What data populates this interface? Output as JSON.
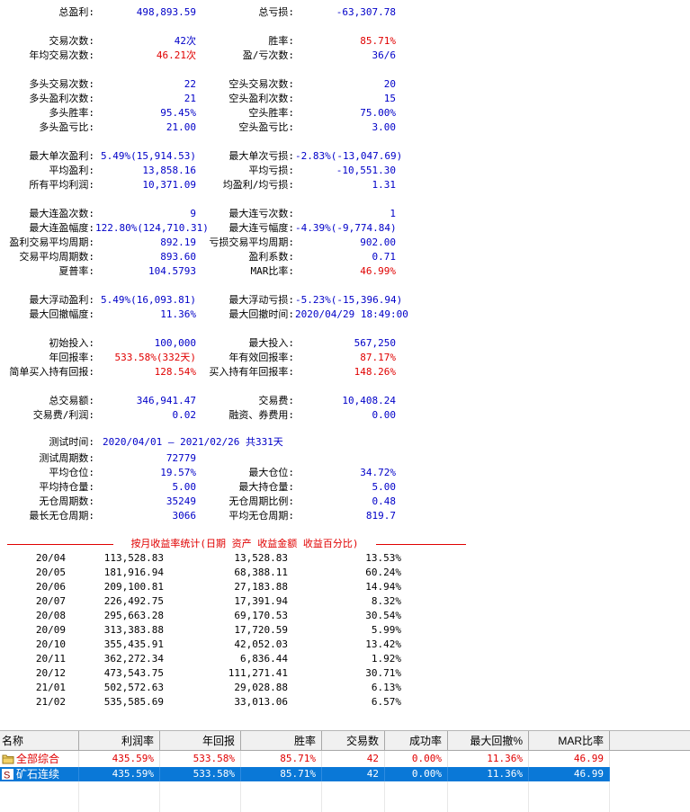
{
  "stats": [
    {
      "row": "r1",
      "l1": "总盈利:",
      "v1": "498,893.59",
      "c1": "blue",
      "l2": "总亏损:",
      "v2": "-63,307.78",
      "c2": "blue"
    },
    {
      "row": "r2",
      "l1": "交易次数:",
      "v1": "42次",
      "c1": "blue",
      "l2": "胜率:",
      "v2": "85.71%",
      "c2": "red"
    },
    {
      "row": "r3",
      "l1": "年均交易次数:",
      "v1": "46.21次",
      "c1": "red",
      "l2": "盈/亏次数:",
      "v2": "36/6",
      "c2": "blue"
    },
    {
      "row": "r4",
      "l1": "多头交易次数:",
      "v1": "22",
      "c1": "blue",
      "l2": "空头交易次数:",
      "v2": "20",
      "c2": "blue"
    },
    {
      "row": "r5",
      "l1": "多头盈利次数:",
      "v1": "21",
      "c1": "blue",
      "l2": "空头盈利次数:",
      "v2": "15",
      "c2": "blue"
    },
    {
      "row": "r6",
      "l1": "多头胜率:",
      "v1": "95.45%",
      "c1": "blue",
      "l2": "空头胜率:",
      "v2": "75.00%",
      "c2": "blue"
    },
    {
      "row": "r7",
      "l1": "多头盈亏比:",
      "v1": "21.00",
      "c1": "blue",
      "l2": "空头盈亏比:",
      "v2": "3.00",
      "c2": "blue"
    },
    {
      "row": "r8",
      "l1": "最大单次盈利:",
      "v1": "5.49%(15,914.53)",
      "c1": "blue",
      "l2": "最大单次亏损:",
      "v2": "-2.83%(-13,047.69)",
      "c2": "blue"
    },
    {
      "row": "r9",
      "l1": "平均盈利:",
      "v1": "13,858.16",
      "c1": "blue",
      "l2": "平均亏损:",
      "v2": "-10,551.30",
      "c2": "blue"
    },
    {
      "row": "r10",
      "l1": "所有平均利润:",
      "v1": "10,371.09",
      "c1": "blue",
      "l2": "均盈利/均亏损:",
      "v2": "1.31",
      "c2": "blue"
    },
    {
      "row": "r11",
      "l1": "最大连盈次数:",
      "v1": "9",
      "c1": "blue",
      "l2": "最大连亏次数:",
      "v2": "1",
      "c2": "blue"
    },
    {
      "row": "r12",
      "l1": "最大连盈幅度:",
      "v1": "122.80%(124,710.31)",
      "c1": "blue",
      "l2": "最大连亏幅度:",
      "v2": "-4.39%(-9,774.84)",
      "c2": "blue"
    },
    {
      "row": "r13",
      "l1": "盈利交易平均周期:",
      "v1": "892.19",
      "c1": "blue",
      "l2": "亏损交易平均周期:",
      "v2": "902.00",
      "c2": "blue"
    },
    {
      "row": "r14",
      "l1": "交易平均周期数:",
      "v1": "893.60",
      "c1": "blue",
      "l2": "盈利系数:",
      "v2": "0.71",
      "c2": "blue"
    },
    {
      "row": "r15",
      "l1": "夏普率:",
      "v1": "104.5793",
      "c1": "blue",
      "l2": "MAR比率:",
      "v2": "46.99%",
      "c2": "red"
    },
    {
      "row": "r16",
      "l1": "最大浮动盈利:",
      "v1": "5.49%(16,093.81)",
      "c1": "blue",
      "l2": "最大浮动亏损:",
      "v2": "-5.23%(-15,396.94)",
      "c2": "blue"
    },
    {
      "row": "r17",
      "l1": "最大回撤幅度:",
      "v1": "11.36%",
      "c1": "blue",
      "l2": "最大回撤时间:",
      "v2": "2020/04/29 18:49:00",
      "c2": "blue"
    },
    {
      "row": "r18",
      "l1": "初始投入:",
      "v1": "100,000",
      "c1": "blue",
      "l2": "最大投入:",
      "v2": "567,250",
      "c2": "blue"
    },
    {
      "row": "r19",
      "l1": "年回报率:",
      "v1": "533.58%(332天)",
      "c1": "red",
      "l2": "年有效回报率:",
      "v2": "87.17%",
      "c2": "red"
    },
    {
      "row": "r20",
      "l1": "简单买入持有回报:",
      "v1": "128.54%",
      "c1": "red",
      "l2": "买入持有年回报率:",
      "v2": "148.26%",
      "c2": "red"
    },
    {
      "row": "r21",
      "l1": "总交易额:",
      "v1": "346,941.47",
      "c1": "blue",
      "l2": "交易费:",
      "v2": "10,408.24",
      "c2": "blue"
    },
    {
      "row": "r22",
      "l1": "交易费/利润:",
      "v1": "0.02",
      "c1": "blue",
      "l2": "融资、券费用:",
      "v2": "0.00",
      "c2": "blue"
    },
    {
      "row": "r24",
      "l1": "测试周期数:",
      "v1": "72779",
      "c1": "blue",
      "l2": "",
      "v2": "",
      "c2": "blue"
    },
    {
      "row": "r25",
      "l1": "平均仓位:",
      "v1": "19.57%",
      "c1": "blue",
      "l2": "最大仓位:",
      "v2": "34.72%",
      "c2": "blue"
    },
    {
      "row": "r26",
      "l1": "平均持仓量:",
      "v1": "5.00",
      "c1": "blue",
      "l2": "最大持仓量:",
      "v2": "5.00",
      "c2": "blue"
    },
    {
      "row": "r27",
      "l1": "无仓周期数:",
      "v1": "35249",
      "c1": "blue",
      "l2": "无仓周期比例:",
      "v2": "0.48",
      "c2": "blue"
    },
    {
      "row": "r28",
      "l1": "最长无仓周期:",
      "v1": "3066",
      "c1": "blue",
      "l2": "平均无仓周期:",
      "v2": "819.7",
      "c2": "blue"
    }
  ],
  "test_time": {
    "label": "测试时间:",
    "value": "2020/04/01 — 2021/02/26  共331天"
  },
  "monthly": {
    "title": "按月收益率统计(日期 资产 收益金额 收益百分比)",
    "rows": [
      [
        "20/04",
        "113,528.83",
        "13,528.83",
        "13.53%"
      ],
      [
        "20/05",
        "181,916.94",
        "68,388.11",
        "60.24%"
      ],
      [
        "20/06",
        "209,100.81",
        "27,183.88",
        "14.94%"
      ],
      [
        "20/07",
        "226,492.75",
        "17,391.94",
        "8.32%"
      ],
      [
        "20/08",
        "295,663.28",
        "69,170.53",
        "30.54%"
      ],
      [
        "20/09",
        "313,383.88",
        "17,720.59",
        "5.99%"
      ],
      [
        "20/10",
        "355,435.91",
        "42,052.03",
        "13.42%"
      ],
      [
        "20/11",
        "362,272.34",
        "6,836.44",
        "1.92%"
      ],
      [
        "20/12",
        "473,543.75",
        "111,271.41",
        "30.71%"
      ],
      [
        "21/01",
        "502,572.63",
        "29,028.88",
        "6.13%"
      ],
      [
        "21/02",
        "535,585.69",
        "33,013.06",
        "6.57%"
      ]
    ]
  },
  "table": {
    "headers": [
      "名称",
      "利润率",
      "年回报",
      "胜率",
      "交易数",
      "成功率",
      "最大回撤%",
      "MAR比率"
    ],
    "rows": [
      {
        "name": "全部综合",
        "icon": "folder-icon",
        "cells": [
          "435.59%",
          "533.58%",
          "85.71%",
          "42",
          "0.00%",
          "11.36%",
          "46.99"
        ],
        "selected": false
      },
      {
        "name": "矿石连续",
        "icon": "strategy-s-icon",
        "cells": [
          "435.59%",
          "533.58%",
          "85.71%",
          "42",
          "0.00%",
          "11.36%",
          "46.99"
        ],
        "selected": true
      }
    ]
  }
}
